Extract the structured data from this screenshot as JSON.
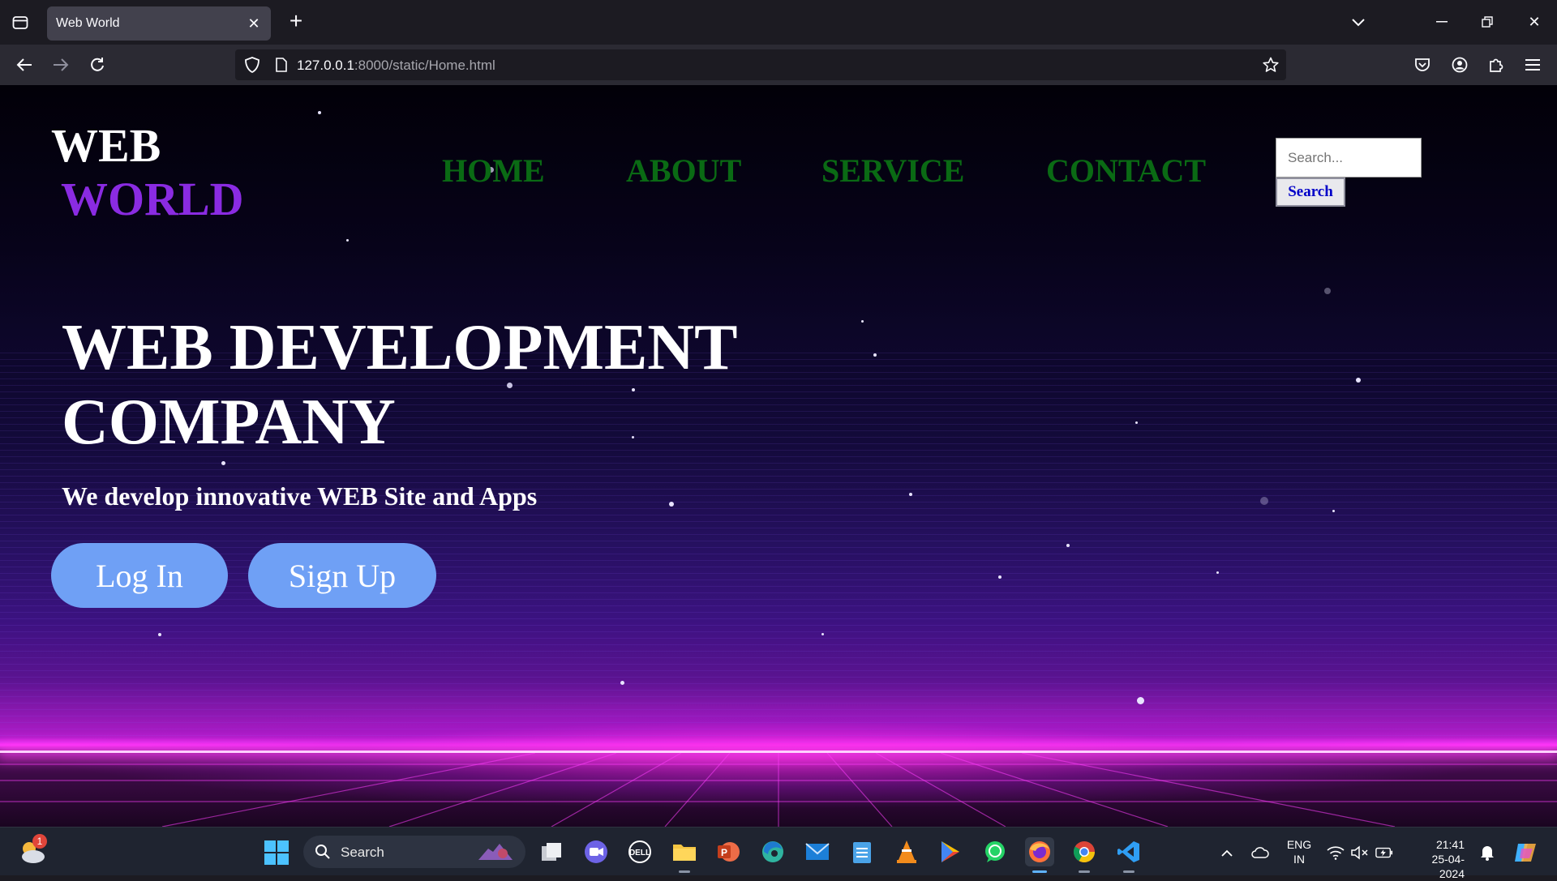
{
  "browser": {
    "tab_title": "Web World",
    "url_host": "127.0.0.1",
    "url_rest": ":8000/static/Home.html"
  },
  "site": {
    "logo_line1": "WEB",
    "logo_line2": "WORLD",
    "menu": [
      "HOME",
      "ABOUT",
      "SERVICE",
      "CONTACT"
    ],
    "search_placeholder": "Search...",
    "search_button": "Search",
    "headline_line1": "WEB DEVELOPMENT",
    "headline_line2": "COMPANY",
    "tagline": "We develop innovative WEB Site and Apps",
    "login_label": "Log In",
    "signup_label": "Sign Up"
  },
  "colors": {
    "logo_accent": "#8a2be2",
    "menu_text": "#0a6a14",
    "cta_bg": "#6fa0f5",
    "search_button_text": "#0000c8"
  },
  "taskbar": {
    "search_label": "Search",
    "weather_badge": "1",
    "language_line1": "ENG",
    "language_line2": "IN",
    "time": "21:41",
    "date": "25-04-2024",
    "apps": [
      "file-explorer-alt",
      "zoom",
      "dell",
      "file-explorer",
      "powerpoint",
      "edge",
      "mail",
      "notepad",
      "vlc",
      "play-store",
      "whatsapp",
      "firefox",
      "chrome",
      "vscode"
    ]
  }
}
